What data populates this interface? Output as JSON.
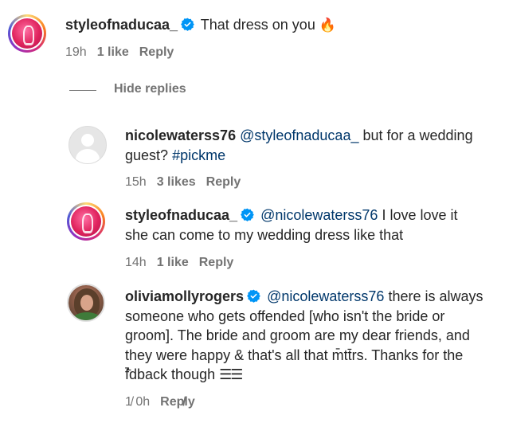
{
  "comments": [
    {
      "username": "styleofnaducaa_",
      "verified": true,
      "text": "That dress on you",
      "emoji": "🔥",
      "time": "19h",
      "likes": "1 like",
      "reply": "Reply"
    },
    {
      "username": "nicolewaterss76",
      "verified": false,
      "mention": "@styleofnaducaa_",
      "text": "but for a wedding guest?",
      "hashtag": "#pickme",
      "time": "15h",
      "likes": "3 likes",
      "reply": "Reply"
    },
    {
      "username": "styleofnaducaa_",
      "verified": true,
      "mention": "@nicolewaterss76",
      "text": "I love love it she can come to my wedding dress like that",
      "time": "14h",
      "likes": "1 like",
      "reply": "Reply"
    },
    {
      "username": "oliviamollyrogers",
      "verified": true,
      "mention": "@nicolewaterss76",
      "text": "there is always someone who gets offended [who isn't the bride or groom]. The bride and groom are my dear friends, and they were happy & that's all that m̄tt̄rs. Thanks for the f̄̄dback though",
      "emoji": "☰☰",
      "time": "1̸ 0h",
      "reply": "Rep̸ly"
    }
  ],
  "hide_replies": "Hide replies",
  "colors": {
    "text": "#262626",
    "meta": "#737373",
    "link": "#00376b",
    "verified": "#0095f6"
  }
}
